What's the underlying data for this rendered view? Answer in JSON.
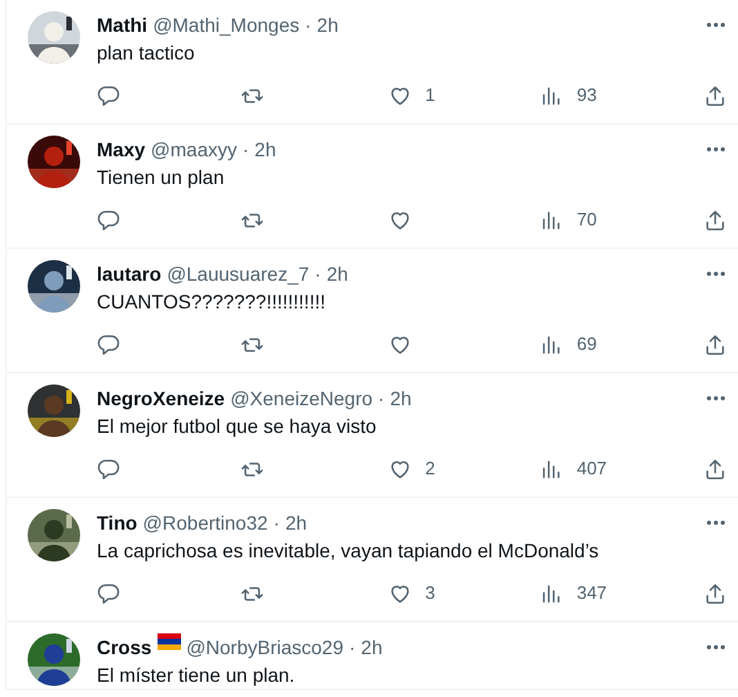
{
  "tweets": [
    {
      "name": "Mathi",
      "handle": "@Mathi_Monges",
      "separator": "·",
      "time": "2h",
      "flag": false,
      "text": "plan tactico",
      "actions": {
        "likes": "1",
        "views": "93"
      }
    },
    {
      "name": "Maxy",
      "handle": "@maaxyy",
      "separator": "·",
      "time": "2h",
      "flag": false,
      "text": "Tienen un plan",
      "actions": {
        "views": "70"
      }
    },
    {
      "name": "lautaro",
      "handle": "@Lauusuarez_7",
      "separator": "·",
      "time": "2h",
      "flag": false,
      "text": "CUANTOS???????!!!!!!!!!!!",
      "actions": {
        "views": "69"
      }
    },
    {
      "name": "NegroXeneize",
      "handle": "@XeneizeNegro",
      "separator": "·",
      "time": "2h",
      "flag": false,
      "text": "El mejor futbol que se haya visto",
      "actions": {
        "likes": "2",
        "views": "407"
      }
    },
    {
      "name": "Tino",
      "handle": "@Robertino32",
      "separator": "·",
      "time": "2h",
      "flag": false,
      "text": "La caprichosa es inevitable, vayan tapiando el McDonald’s",
      "actions": {
        "likes": "3",
        "views": "347"
      }
    },
    {
      "name": "Cross",
      "handle": "@NorbyBriasco29",
      "separator": "·",
      "time": "2h",
      "flag": true,
      "text": "El míster tiene un plan."
    }
  ]
}
